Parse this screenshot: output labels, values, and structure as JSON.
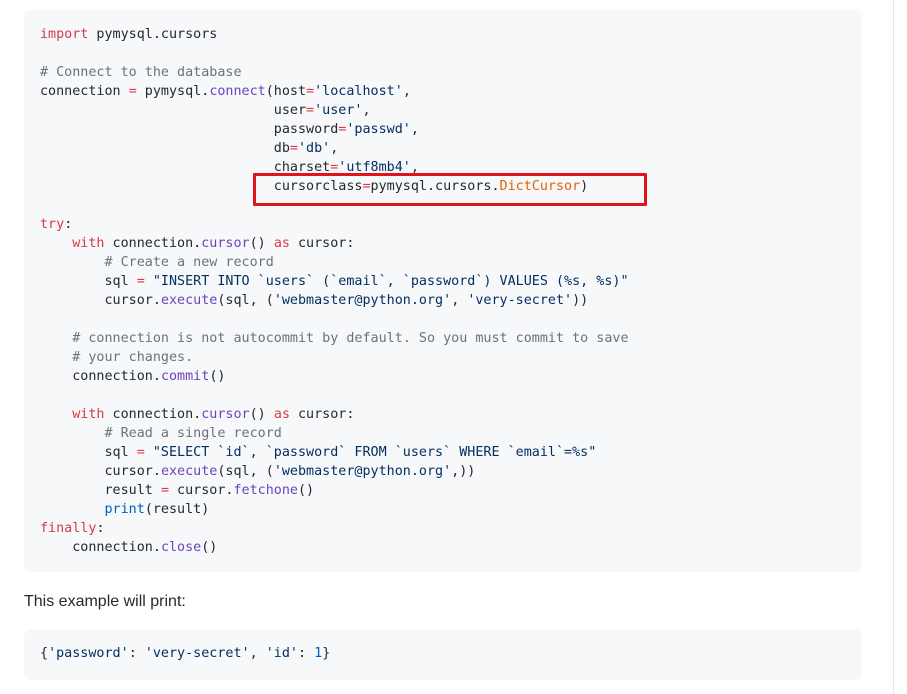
{
  "code_main": {
    "lines": [
      [
        {
          "t": "import",
          "c": "k"
        },
        {
          "t": " pymysql.cursors",
          "c": "p"
        }
      ],
      [],
      [
        {
          "t": "# Connect to the database",
          "c": "c"
        }
      ],
      [
        {
          "t": "connection ",
          "c": "p"
        },
        {
          "t": "=",
          "c": "o"
        },
        {
          "t": " pymysql.",
          "c": "p"
        },
        {
          "t": "connect",
          "c": "f"
        },
        {
          "t": "(host",
          "c": "p"
        },
        {
          "t": "=",
          "c": "o"
        },
        {
          "t": "'localhost'",
          "c": "s"
        },
        {
          "t": ",",
          "c": "p"
        }
      ],
      [
        {
          "t": "                             user",
          "c": "p"
        },
        {
          "t": "=",
          "c": "o"
        },
        {
          "t": "'user'",
          "c": "s"
        },
        {
          "t": ",",
          "c": "p"
        }
      ],
      [
        {
          "t": "                             password",
          "c": "p"
        },
        {
          "t": "=",
          "c": "o"
        },
        {
          "t": "'passwd'",
          "c": "s"
        },
        {
          "t": ",",
          "c": "p"
        }
      ],
      [
        {
          "t": "                             db",
          "c": "p"
        },
        {
          "t": "=",
          "c": "o"
        },
        {
          "t": "'db'",
          "c": "s"
        },
        {
          "t": ",",
          "c": "p"
        }
      ],
      [
        {
          "t": "                             charset",
          "c": "p"
        },
        {
          "t": "=",
          "c": "o"
        },
        {
          "t": "'utf8mb4'",
          "c": "s"
        },
        {
          "t": ",",
          "c": "p"
        }
      ],
      [
        {
          "t": "                             cursorclass",
          "c": "p"
        },
        {
          "t": "=",
          "c": "o"
        },
        {
          "t": "pymysql.cursors.",
          "c": "p"
        },
        {
          "t": "DictCursor",
          "c": "cls"
        },
        {
          "t": ")",
          "c": "p"
        }
      ],
      [],
      [
        {
          "t": "try",
          "c": "k"
        },
        {
          "t": ":",
          "c": "p"
        }
      ],
      [
        {
          "t": "    ",
          "c": "p"
        },
        {
          "t": "with",
          "c": "k"
        },
        {
          "t": " connection.",
          "c": "p"
        },
        {
          "t": "cursor",
          "c": "f"
        },
        {
          "t": "() ",
          "c": "p"
        },
        {
          "t": "as",
          "c": "k"
        },
        {
          "t": " cursor:",
          "c": "p"
        }
      ],
      [
        {
          "t": "        ",
          "c": "p"
        },
        {
          "t": "# Create a new record",
          "c": "c"
        }
      ],
      [
        {
          "t": "        sql ",
          "c": "p"
        },
        {
          "t": "=",
          "c": "o"
        },
        {
          "t": " ",
          "c": "p"
        },
        {
          "t": "\"INSERT INTO `users` (`email`, `password`) VALUES (%s, %s)\"",
          "c": "s"
        }
      ],
      [
        {
          "t": "        cursor.",
          "c": "p"
        },
        {
          "t": "execute",
          "c": "f"
        },
        {
          "t": "(sql, (",
          "c": "p"
        },
        {
          "t": "'webmaster@python.org'",
          "c": "s"
        },
        {
          "t": ", ",
          "c": "p"
        },
        {
          "t": "'very-secret'",
          "c": "s"
        },
        {
          "t": "))",
          "c": "p"
        }
      ],
      [],
      [
        {
          "t": "    ",
          "c": "p"
        },
        {
          "t": "# connection is not autocommit by default. So you must commit to save",
          "c": "c"
        }
      ],
      [
        {
          "t": "    ",
          "c": "p"
        },
        {
          "t": "# your changes.",
          "c": "c"
        }
      ],
      [
        {
          "t": "    connection.",
          "c": "p"
        },
        {
          "t": "commit",
          "c": "f"
        },
        {
          "t": "()",
          "c": "p"
        }
      ],
      [],
      [
        {
          "t": "    ",
          "c": "p"
        },
        {
          "t": "with",
          "c": "k"
        },
        {
          "t": " connection.",
          "c": "p"
        },
        {
          "t": "cursor",
          "c": "f"
        },
        {
          "t": "() ",
          "c": "p"
        },
        {
          "t": "as",
          "c": "k"
        },
        {
          "t": " cursor:",
          "c": "p"
        }
      ],
      [
        {
          "t": "        ",
          "c": "p"
        },
        {
          "t": "# Read a single record",
          "c": "c"
        }
      ],
      [
        {
          "t": "        sql ",
          "c": "p"
        },
        {
          "t": "=",
          "c": "o"
        },
        {
          "t": " ",
          "c": "p"
        },
        {
          "t": "\"SELECT `id`, `password` FROM `users` WHERE `email`=%s\"",
          "c": "s"
        }
      ],
      [
        {
          "t": "        cursor.",
          "c": "p"
        },
        {
          "t": "execute",
          "c": "f"
        },
        {
          "t": "(sql, (",
          "c": "p"
        },
        {
          "t": "'webmaster@python.org'",
          "c": "s"
        },
        {
          "t": ",))",
          "c": "p"
        }
      ],
      [
        {
          "t": "        result ",
          "c": "p"
        },
        {
          "t": "=",
          "c": "o"
        },
        {
          "t": " cursor.",
          "c": "p"
        },
        {
          "t": "fetchone",
          "c": "f"
        },
        {
          "t": "()",
          "c": "p"
        }
      ],
      [
        {
          "t": "        ",
          "c": "p"
        },
        {
          "t": "print",
          "c": "n"
        },
        {
          "t": "(result)",
          "c": "p"
        }
      ],
      [
        {
          "t": "finally",
          "c": "k"
        },
        {
          "t": ":",
          "c": "p"
        }
      ],
      [
        {
          "t": "    connection.",
          "c": "p"
        },
        {
          "t": "close",
          "c": "f"
        },
        {
          "t": "()",
          "c": "p"
        }
      ]
    ]
  },
  "prose": {
    "text": "This example will print:"
  },
  "code_output": {
    "lines": [
      [
        {
          "t": "{",
          "c": "p"
        },
        {
          "t": "'password'",
          "c": "s"
        },
        {
          "t": ": ",
          "c": "p"
        },
        {
          "t": "'very-secret'",
          "c": "s"
        },
        {
          "t": ", ",
          "c": "p"
        },
        {
          "t": "'id'",
          "c": "s"
        },
        {
          "t": ": ",
          "c": "p"
        },
        {
          "t": "1",
          "c": "n"
        },
        {
          "t": "}",
          "c": "p"
        }
      ]
    ]
  },
  "colors": {
    "keyword": "#d73a49",
    "comment": "#6a737d",
    "string": "#032f62",
    "function": "#6f42c1",
    "number": "#005cc5",
    "class": "#e36209",
    "highlight_box": "#e0151b",
    "code_background": "#f6f8fa"
  }
}
